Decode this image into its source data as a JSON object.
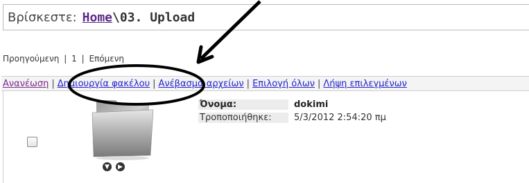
{
  "breadcrumb": {
    "label": "Βρίσκεστε:",
    "home": "Home",
    "path": "\\03. Upload"
  },
  "pager": {
    "previous": "Προηγούμενη",
    "separator": "|",
    "page": "1",
    "next": "Επόμενη"
  },
  "toolbar": {
    "refresh": "Ανανέωση",
    "create_folder": "Δημιουργία φακέλου",
    "upload_files": "Ανέβασμα αρχείων",
    "select_all": "Επιλογή όλων",
    "download_selected": "Λήψη επιλεγμένων",
    "separator": "|"
  },
  "item": {
    "name_label": "Όνομα:",
    "name_value": "dokimi",
    "modified_label": "Τροποποιήθηκε:",
    "modified_value": "5/3/2012 2:54:20 πμ",
    "icon": "folder-icon"
  },
  "colors": {
    "link": "#2222cc",
    "visited": "#7a2a8c"
  }
}
